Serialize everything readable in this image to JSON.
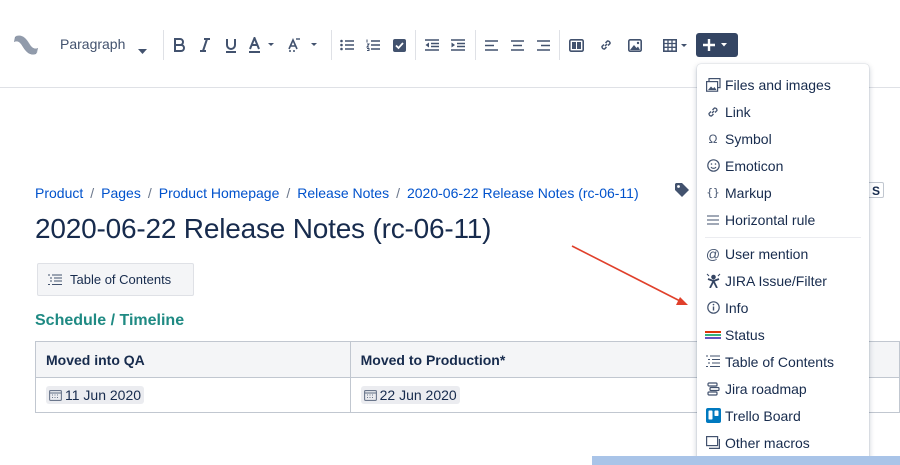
{
  "toolbar": {
    "paragraph_label": "Paragraph",
    "colors": {
      "insert_button_bg": "#344563",
      "icon": "#42526e"
    }
  },
  "breadcrumb": {
    "items": [
      "Product",
      "Pages",
      "Product Homepage",
      "Release Notes",
      "2020-06-22 Release Notes (rc-06-11)"
    ],
    "separator": "/",
    "partial_label": "S"
  },
  "page": {
    "title": "2020-06-22 Release Notes (rc-06-11)",
    "toc_macro_label": "Table of Contents",
    "section_heading": "Schedule / Timeline"
  },
  "table": {
    "headers": [
      "Moved into QA",
      "Moved to Production*"
    ],
    "rows": [
      [
        "11 Jun 2020",
        "22 Jun 2020"
      ]
    ]
  },
  "insert_menu": {
    "items": [
      {
        "label": "Files and images",
        "icon": "image-icon"
      },
      {
        "label": "Link",
        "icon": "link-icon"
      },
      {
        "label": "Symbol",
        "icon": "omega-icon"
      },
      {
        "label": "Emoticon",
        "icon": "smiley-icon"
      },
      {
        "label": "Markup",
        "icon": "braces-icon"
      },
      {
        "label": "Horizontal rule",
        "icon": "horizontal-rule-icon"
      },
      {
        "label": "User mention",
        "icon": "at-icon"
      },
      {
        "label": "JIRA Issue/Filter",
        "icon": "jira-icon"
      },
      {
        "label": "Info",
        "icon": "info-icon"
      },
      {
        "label": "Status",
        "icon": "status-icon"
      },
      {
        "label": "Table of Contents",
        "icon": "toc-icon"
      },
      {
        "label": "Jira roadmap",
        "icon": "roadmap-icon"
      },
      {
        "label": "Trello Board",
        "icon": "trello-icon"
      },
      {
        "label": "Other macros",
        "icon": "macro-icon"
      }
    ]
  },
  "colors": {
    "link": "#0052cc",
    "heading_green": "#1f8a83",
    "annotation_arrow": "#e0402b"
  }
}
